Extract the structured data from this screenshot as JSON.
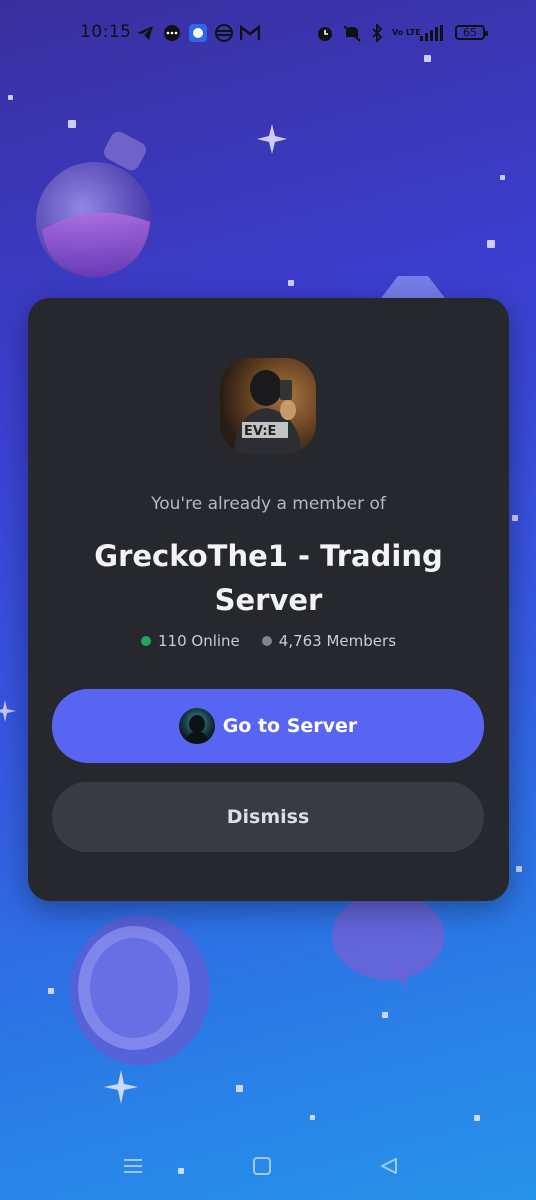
{
  "status_bar": {
    "time": "10:15",
    "battery": "65",
    "icons": [
      "telegram-icon",
      "chat-icon",
      "signal-app-icon",
      "vpn-icon",
      "gmail-icon",
      "alarm-icon",
      "mute-icon",
      "bluetooth-icon",
      "volte-icon",
      "cellular-signal-icon"
    ],
    "volte_label": "Vo LTE"
  },
  "dialog": {
    "subtitle": "You're already a member of",
    "server_name": "GreckoThe1 - Trading Server",
    "online": "110 Online",
    "members": "4,763 Members",
    "online_color": "#23a55a",
    "members_color": "#80848e",
    "go_button": "Go to Server",
    "dismiss_button": "Dismiss"
  },
  "nav_bar": {
    "icons": [
      "menu-icon",
      "home-square-icon",
      "back-triangle-icon"
    ]
  },
  "colors": {
    "accent": "#5865f2",
    "modal_bg": "#27282d"
  }
}
